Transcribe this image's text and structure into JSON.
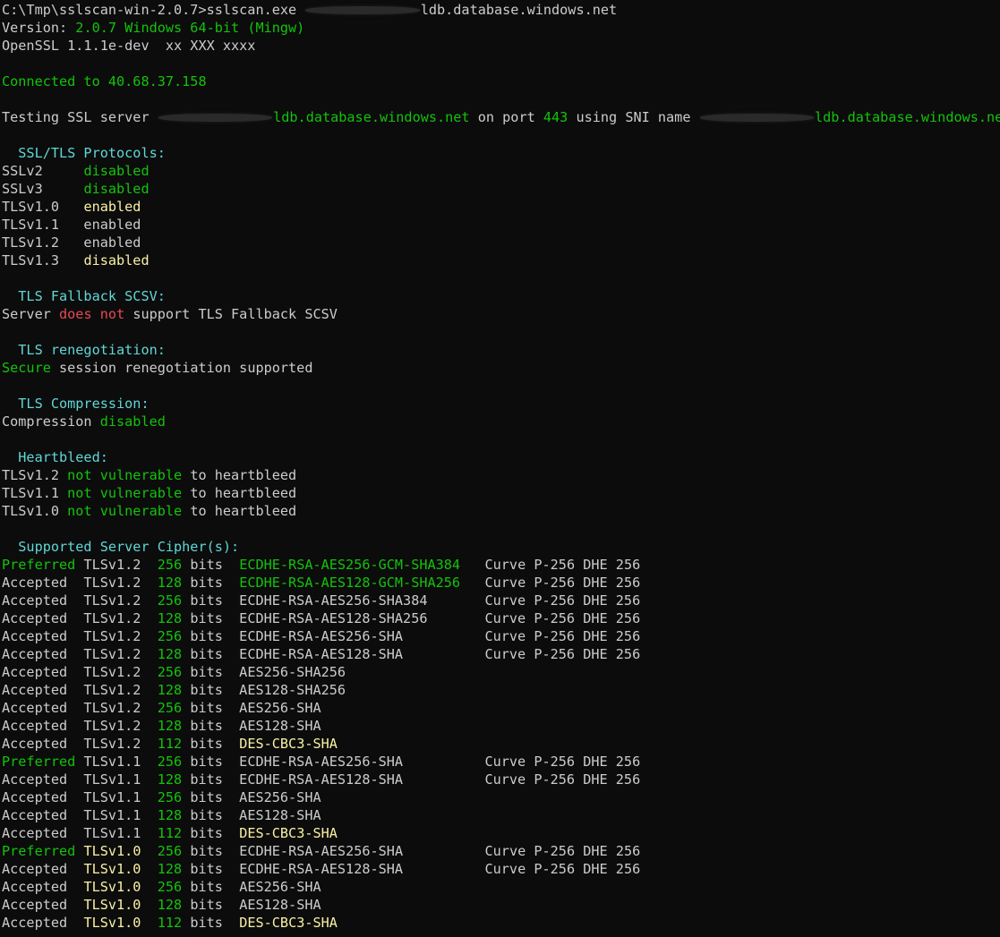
{
  "palette": {
    "background": "#0c0c0c",
    "default_text": "#cccccc",
    "green": "#13c30b",
    "cyan": "#61d6d6",
    "yellow": "#f9f1a5",
    "red": "#e74856"
  },
  "lines": [
    [
      [
        "w",
        "C:\\Tmp\\sslscan-win-2.0.7>sslscan.exe "
      ],
      [
        "redact",
        "f-xx-dev-dx-sq"
      ],
      [
        "w",
        "ldb.database.windows.net"
      ]
    ],
    [
      [
        "w",
        "Version: "
      ],
      [
        "g",
        "2.0.7 Windows 64-bit (Mingw)"
      ]
    ],
    [
      [
        "w",
        "OpenSSL 1.1.1e-dev  xx XXX xxxx"
      ]
    ],
    [],
    [
      [
        "g",
        "Connected to 40.68.37.158"
      ]
    ],
    [],
    [
      [
        "w",
        "Testing SSL server "
      ],
      [
        "redact",
        "f-xx-dev-dx-sq"
      ],
      [
        "g",
        "ldb.database.windows.net"
      ],
      [
        "w",
        " on port "
      ],
      [
        "g",
        "443"
      ],
      [
        "w",
        " using SNI name "
      ],
      [
        "redact",
        "f-xx-dev-dx-sq"
      ],
      [
        "g",
        "ldb.database.windows.net"
      ]
    ],
    [],
    [
      [
        "c",
        "  SSL/TLS Protocols:"
      ]
    ],
    [
      [
        "w",
        "SSLv2     "
      ],
      [
        "g",
        "disabled"
      ]
    ],
    [
      [
        "w",
        "SSLv3     "
      ],
      [
        "g",
        "disabled"
      ]
    ],
    [
      [
        "w",
        "TLSv1.0   "
      ],
      [
        "y",
        "enabled"
      ]
    ],
    [
      [
        "w",
        "TLSv1.1   enabled"
      ]
    ],
    [
      [
        "w",
        "TLSv1.2   enabled"
      ]
    ],
    [
      [
        "w",
        "TLSv1.3   "
      ],
      [
        "y",
        "disabled"
      ]
    ],
    [],
    [
      [
        "c",
        "  TLS Fallback SCSV:"
      ]
    ],
    [
      [
        "w",
        "Server "
      ],
      [
        "r",
        "does not"
      ],
      [
        "w",
        " support TLS Fallback SCSV"
      ]
    ],
    [],
    [
      [
        "c",
        "  TLS renegotiation:"
      ]
    ],
    [
      [
        "g",
        "Secure"
      ],
      [
        "w",
        " session renegotiation supported"
      ]
    ],
    [],
    [
      [
        "c",
        "  TLS Compression:"
      ]
    ],
    [
      [
        "w",
        "Compression "
      ],
      [
        "g",
        "disabled"
      ]
    ],
    [],
    [
      [
        "c",
        "  Heartbleed:"
      ]
    ],
    [
      [
        "w",
        "TLSv1.2 "
      ],
      [
        "g",
        "not vulnerable"
      ],
      [
        "w",
        " to heartbleed"
      ]
    ],
    [
      [
        "w",
        "TLSv1.1 "
      ],
      [
        "g",
        "not vulnerable"
      ],
      [
        "w",
        " to heartbleed"
      ]
    ],
    [
      [
        "w",
        "TLSv1.0 "
      ],
      [
        "g",
        "not vulnerable"
      ],
      [
        "w",
        " to heartbleed"
      ]
    ],
    [],
    [
      [
        "c",
        "  Supported Server Cipher(s):"
      ]
    ],
    [
      [
        "g",
        "Preferred"
      ],
      [
        "w",
        " TLSv1.2  "
      ],
      [
        "g",
        "256"
      ],
      [
        "w",
        " bits  "
      ],
      [
        "g",
        "ECDHE-RSA-AES256-GCM-SHA384  "
      ],
      [
        "w",
        " Curve P-256 DHE 256"
      ]
    ],
    [
      [
        "w",
        "Accepted  TLSv1.2  "
      ],
      [
        "g",
        "128"
      ],
      [
        "w",
        " bits  "
      ],
      [
        "g",
        "ECDHE-RSA-AES128-GCM-SHA256  "
      ],
      [
        "w",
        " Curve P-256 DHE 256"
      ]
    ],
    [
      [
        "w",
        "Accepted  TLSv1.2  "
      ],
      [
        "g",
        "256"
      ],
      [
        "w",
        " bits  ECDHE-RSA-AES256-SHA384       Curve P-256 DHE 256"
      ]
    ],
    [
      [
        "w",
        "Accepted  TLSv1.2  "
      ],
      [
        "g",
        "128"
      ],
      [
        "w",
        " bits  ECDHE-RSA-AES128-SHA256       Curve P-256 DHE 256"
      ]
    ],
    [
      [
        "w",
        "Accepted  TLSv1.2  "
      ],
      [
        "g",
        "256"
      ],
      [
        "w",
        " bits  ECDHE-RSA-AES256-SHA          Curve P-256 DHE 256"
      ]
    ],
    [
      [
        "w",
        "Accepted  TLSv1.2  "
      ],
      [
        "g",
        "128"
      ],
      [
        "w",
        " bits  ECDHE-RSA-AES128-SHA          Curve P-256 DHE 256"
      ]
    ],
    [
      [
        "w",
        "Accepted  TLSv1.2  "
      ],
      [
        "g",
        "256"
      ],
      [
        "w",
        " bits  AES256-SHA256"
      ]
    ],
    [
      [
        "w",
        "Accepted  TLSv1.2  "
      ],
      [
        "g",
        "128"
      ],
      [
        "w",
        " bits  AES128-SHA256"
      ]
    ],
    [
      [
        "w",
        "Accepted  TLSv1.2  "
      ],
      [
        "g",
        "256"
      ],
      [
        "w",
        " bits  AES256-SHA"
      ]
    ],
    [
      [
        "w",
        "Accepted  TLSv1.2  "
      ],
      [
        "g",
        "128"
      ],
      [
        "w",
        " bits  AES128-SHA"
      ]
    ],
    [
      [
        "w",
        "Accepted  TLSv1.2  "
      ],
      [
        "g",
        "112"
      ],
      [
        "w",
        " bits  "
      ],
      [
        "y",
        "DES-CBC3-SHA"
      ]
    ],
    [
      [
        "g",
        "Preferred"
      ],
      [
        "w",
        " TLSv1.1  "
      ],
      [
        "g",
        "256"
      ],
      [
        "w",
        " bits  ECDHE-RSA-AES256-SHA          Curve P-256 DHE 256"
      ]
    ],
    [
      [
        "w",
        "Accepted  TLSv1.1  "
      ],
      [
        "g",
        "128"
      ],
      [
        "w",
        " bits  ECDHE-RSA-AES128-SHA          Curve P-256 DHE 256"
      ]
    ],
    [
      [
        "w",
        "Accepted  TLSv1.1  "
      ],
      [
        "g",
        "256"
      ],
      [
        "w",
        " bits  AES256-SHA"
      ]
    ],
    [
      [
        "w",
        "Accepted  TLSv1.1  "
      ],
      [
        "g",
        "128"
      ],
      [
        "w",
        " bits  AES128-SHA"
      ]
    ],
    [
      [
        "w",
        "Accepted  TLSv1.1  "
      ],
      [
        "g",
        "112"
      ],
      [
        "w",
        " bits  "
      ],
      [
        "y",
        "DES-CBC3-SHA"
      ]
    ],
    [
      [
        "g",
        "Preferred"
      ],
      [
        "w",
        " "
      ],
      [
        "y",
        "TLSv1.0"
      ],
      [
        "w",
        "  "
      ],
      [
        "g",
        "256"
      ],
      [
        "w",
        " bits  ECDHE-RSA-AES256-SHA          Curve P-256 DHE 256"
      ]
    ],
    [
      [
        "w",
        "Accepted  "
      ],
      [
        "y",
        "TLSv1.0"
      ],
      [
        "w",
        "  "
      ],
      [
        "g",
        "128"
      ],
      [
        "w",
        " bits  ECDHE-RSA-AES128-SHA          Curve P-256 DHE 256"
      ]
    ],
    [
      [
        "w",
        "Accepted  "
      ],
      [
        "y",
        "TLSv1.0"
      ],
      [
        "w",
        "  "
      ],
      [
        "g",
        "256"
      ],
      [
        "w",
        " bits  AES256-SHA"
      ]
    ],
    [
      [
        "w",
        "Accepted  "
      ],
      [
        "y",
        "TLSv1.0"
      ],
      [
        "w",
        "  "
      ],
      [
        "g",
        "128"
      ],
      [
        "w",
        " bits  AES128-SHA"
      ]
    ],
    [
      [
        "w",
        "Accepted  "
      ],
      [
        "y",
        "TLSv1.0"
      ],
      [
        "w",
        "  "
      ],
      [
        "g",
        "112"
      ],
      [
        "w",
        " bits  "
      ],
      [
        "y",
        "DES-CBC3-SHA"
      ]
    ]
  ]
}
